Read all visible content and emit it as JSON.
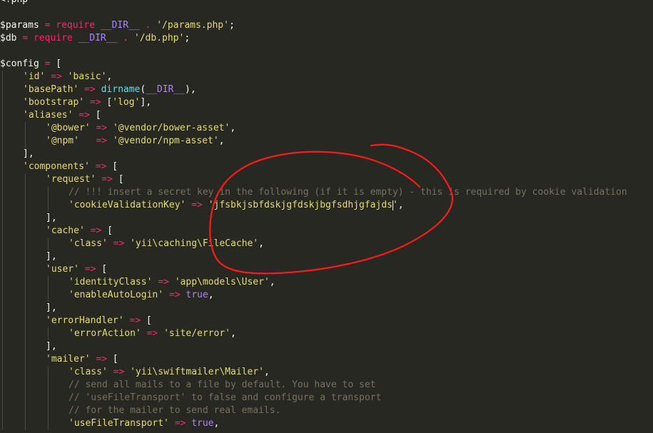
{
  "editor": {
    "lines": [
      {
        "indent": 0,
        "tokens": [
          {
            "t": "tag",
            "v": "<?php"
          }
        ]
      },
      {
        "indent": 0,
        "tokens": []
      },
      {
        "indent": 0,
        "tokens": [
          {
            "t": "var",
            "v": "$params"
          },
          {
            "t": "plain",
            "v": " "
          },
          {
            "t": "op",
            "v": "="
          },
          {
            "t": "plain",
            "v": " "
          },
          {
            "t": "kw",
            "v": "require"
          },
          {
            "t": "plain",
            "v": " "
          },
          {
            "t": "const",
            "v": "__DIR__"
          },
          {
            "t": "plain",
            "v": " "
          },
          {
            "t": "op",
            "v": "."
          },
          {
            "t": "plain",
            "v": " "
          },
          {
            "t": "str",
            "v": "'/params.php'"
          },
          {
            "t": "plain",
            "v": ";"
          }
        ]
      },
      {
        "indent": 0,
        "tokens": [
          {
            "t": "var",
            "v": "$db"
          },
          {
            "t": "plain",
            "v": " "
          },
          {
            "t": "op",
            "v": "="
          },
          {
            "t": "plain",
            "v": " "
          },
          {
            "t": "kw",
            "v": "require"
          },
          {
            "t": "plain",
            "v": " "
          },
          {
            "t": "const",
            "v": "__DIR__"
          },
          {
            "t": "plain",
            "v": " "
          },
          {
            "t": "op",
            "v": "."
          },
          {
            "t": "plain",
            "v": " "
          },
          {
            "t": "str",
            "v": "'/db.php'"
          },
          {
            "t": "plain",
            "v": ";"
          }
        ]
      },
      {
        "indent": 0,
        "tokens": []
      },
      {
        "indent": 0,
        "tokens": [
          {
            "t": "var",
            "v": "$config"
          },
          {
            "t": "plain",
            "v": " "
          },
          {
            "t": "op",
            "v": "="
          },
          {
            "t": "plain",
            "v": " ["
          }
        ]
      },
      {
        "indent": 1,
        "tokens": [
          {
            "t": "str",
            "v": "'id'"
          },
          {
            "t": "plain",
            "v": " "
          },
          {
            "t": "op",
            "v": "=>"
          },
          {
            "t": "plain",
            "v": " "
          },
          {
            "t": "str",
            "v": "'basic'"
          },
          {
            "t": "plain",
            "v": ","
          }
        ]
      },
      {
        "indent": 1,
        "tokens": [
          {
            "t": "str",
            "v": "'basePath'"
          },
          {
            "t": "plain",
            "v": " "
          },
          {
            "t": "op",
            "v": "=>"
          },
          {
            "t": "plain",
            "v": " "
          },
          {
            "t": "fn",
            "v": "dirname"
          },
          {
            "t": "plain",
            "v": "("
          },
          {
            "t": "const",
            "v": "__DIR__"
          },
          {
            "t": "plain",
            "v": "),"
          }
        ]
      },
      {
        "indent": 1,
        "tokens": [
          {
            "t": "str",
            "v": "'bootstrap'"
          },
          {
            "t": "plain",
            "v": " "
          },
          {
            "t": "op",
            "v": "=>"
          },
          {
            "t": "plain",
            "v": " ["
          },
          {
            "t": "str",
            "v": "'log'"
          },
          {
            "t": "plain",
            "v": "],"
          }
        ]
      },
      {
        "indent": 1,
        "tokens": [
          {
            "t": "str",
            "v": "'aliases'"
          },
          {
            "t": "plain",
            "v": " "
          },
          {
            "t": "op",
            "v": "=>"
          },
          {
            "t": "plain",
            "v": " ["
          }
        ]
      },
      {
        "indent": 2,
        "tokens": [
          {
            "t": "str",
            "v": "'@bower'"
          },
          {
            "t": "plain",
            "v": " "
          },
          {
            "t": "op",
            "v": "=>"
          },
          {
            "t": "plain",
            "v": " "
          },
          {
            "t": "str",
            "v": "'@vendor/bower-asset'"
          },
          {
            "t": "plain",
            "v": ","
          }
        ]
      },
      {
        "indent": 2,
        "tokens": [
          {
            "t": "str",
            "v": "'@npm'"
          },
          {
            "t": "plain",
            "v": "   "
          },
          {
            "t": "op",
            "v": "=>"
          },
          {
            "t": "plain",
            "v": " "
          },
          {
            "t": "str",
            "v": "'@vendor/npm-asset'"
          },
          {
            "t": "plain",
            "v": ","
          }
        ]
      },
      {
        "indent": 1,
        "tokens": [
          {
            "t": "plain",
            "v": "],"
          }
        ]
      },
      {
        "indent": 1,
        "tokens": [
          {
            "t": "str",
            "v": "'components'"
          },
          {
            "t": "plain",
            "v": " "
          },
          {
            "t": "op",
            "v": "=>"
          },
          {
            "t": "plain",
            "v": " ["
          }
        ]
      },
      {
        "indent": 2,
        "tokens": [
          {
            "t": "str",
            "v": "'request'"
          },
          {
            "t": "plain",
            "v": " "
          },
          {
            "t": "op",
            "v": "=>"
          },
          {
            "t": "plain",
            "v": " ["
          }
        ]
      },
      {
        "indent": 3,
        "tokens": [
          {
            "t": "cmt",
            "v": "// !!! insert a secret key in the following (if it is empty) - this is required by cookie validation"
          }
        ]
      },
      {
        "indent": 3,
        "tokens": [
          {
            "t": "str",
            "v": "'cookieValidationKey'"
          },
          {
            "t": "plain",
            "v": " "
          },
          {
            "t": "op",
            "v": "=>"
          },
          {
            "t": "plain",
            "v": " "
          },
          {
            "t": "str",
            "v": "'jfsbkjsbfdskjgfdskjbgfsdhjgfajds"
          },
          {
            "t": "caret",
            "v": ""
          },
          {
            "t": "str",
            "v": "'"
          },
          {
            "t": "plain",
            "v": ","
          }
        ]
      },
      {
        "indent": 2,
        "tokens": [
          {
            "t": "plain",
            "v": "],"
          }
        ]
      },
      {
        "indent": 2,
        "tokens": [
          {
            "t": "str",
            "v": "'cache'"
          },
          {
            "t": "plain",
            "v": " "
          },
          {
            "t": "op",
            "v": "=>"
          },
          {
            "t": "plain",
            "v": " ["
          }
        ]
      },
      {
        "indent": 3,
        "tokens": [
          {
            "t": "str",
            "v": "'class'"
          },
          {
            "t": "plain",
            "v": " "
          },
          {
            "t": "op",
            "v": "=>"
          },
          {
            "t": "plain",
            "v": " "
          },
          {
            "t": "str",
            "v": "'yii\\caching\\FileCache'"
          },
          {
            "t": "plain",
            "v": ","
          }
        ]
      },
      {
        "indent": 2,
        "tokens": [
          {
            "t": "plain",
            "v": "],"
          }
        ]
      },
      {
        "indent": 2,
        "tokens": [
          {
            "t": "str",
            "v": "'user'"
          },
          {
            "t": "plain",
            "v": " "
          },
          {
            "t": "op",
            "v": "=>"
          },
          {
            "t": "plain",
            "v": " ["
          }
        ]
      },
      {
        "indent": 3,
        "tokens": [
          {
            "t": "str",
            "v": "'identityClass'"
          },
          {
            "t": "plain",
            "v": " "
          },
          {
            "t": "op",
            "v": "=>"
          },
          {
            "t": "plain",
            "v": " "
          },
          {
            "t": "str",
            "v": "'app\\models\\User'"
          },
          {
            "t": "plain",
            "v": ","
          }
        ]
      },
      {
        "indent": 3,
        "tokens": [
          {
            "t": "str",
            "v": "'enableAutoLogin'"
          },
          {
            "t": "plain",
            "v": " "
          },
          {
            "t": "op",
            "v": "=>"
          },
          {
            "t": "plain",
            "v": " "
          },
          {
            "t": "const",
            "v": "true"
          },
          {
            "t": "plain",
            "v": ","
          }
        ]
      },
      {
        "indent": 2,
        "tokens": [
          {
            "t": "plain",
            "v": "],"
          }
        ]
      },
      {
        "indent": 2,
        "tokens": [
          {
            "t": "str",
            "v": "'errorHandler'"
          },
          {
            "t": "plain",
            "v": " "
          },
          {
            "t": "op",
            "v": "=>"
          },
          {
            "t": "plain",
            "v": " ["
          }
        ]
      },
      {
        "indent": 3,
        "tokens": [
          {
            "t": "str",
            "v": "'errorAction'"
          },
          {
            "t": "plain",
            "v": " "
          },
          {
            "t": "op",
            "v": "=>"
          },
          {
            "t": "plain",
            "v": " "
          },
          {
            "t": "str",
            "v": "'site/error'"
          },
          {
            "t": "plain",
            "v": ","
          }
        ]
      },
      {
        "indent": 2,
        "tokens": [
          {
            "t": "plain",
            "v": "],"
          }
        ]
      },
      {
        "indent": 2,
        "tokens": [
          {
            "t": "str",
            "v": "'mailer'"
          },
          {
            "t": "plain",
            "v": " "
          },
          {
            "t": "op",
            "v": "=>"
          },
          {
            "t": "plain",
            "v": " ["
          }
        ]
      },
      {
        "indent": 3,
        "tokens": [
          {
            "t": "str",
            "v": "'class'"
          },
          {
            "t": "plain",
            "v": " "
          },
          {
            "t": "op",
            "v": "=>"
          },
          {
            "t": "plain",
            "v": " "
          },
          {
            "t": "str",
            "v": "'yii\\swiftmailer\\Mailer'"
          },
          {
            "t": "plain",
            "v": ","
          }
        ]
      },
      {
        "indent": 3,
        "tokens": [
          {
            "t": "cmt",
            "v": "// send all mails to a file by default. You have to set"
          }
        ]
      },
      {
        "indent": 3,
        "tokens": [
          {
            "t": "cmt",
            "v": "// 'useFileTransport' to false and configure a transport"
          }
        ]
      },
      {
        "indent": 3,
        "tokens": [
          {
            "t": "cmt",
            "v": "// for the mailer to send real emails."
          }
        ]
      },
      {
        "indent": 3,
        "tokens": [
          {
            "t": "str",
            "v": "'useFileTransport'"
          },
          {
            "t": "plain",
            "v": " "
          },
          {
            "t": "op",
            "v": "=>"
          },
          {
            "t": "plain",
            "v": " "
          },
          {
            "t": "const",
            "v": "true"
          },
          {
            "t": "plain",
            "v": ","
          }
        ]
      }
    ]
  },
  "annotation": {
    "shape": "hand-drawn-circle",
    "color": "#ff1a1a",
    "target": "cookieValidationKey"
  }
}
